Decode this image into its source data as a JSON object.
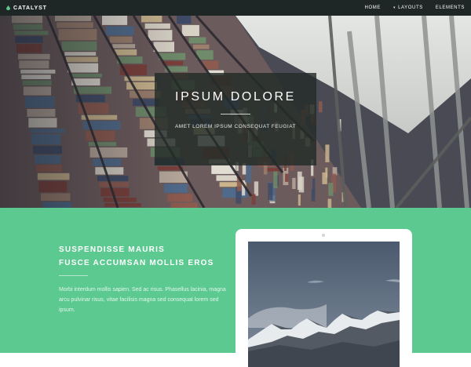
{
  "nav": {
    "brand": "CATALYST",
    "links": [
      {
        "label": "HOME",
        "has_caret": false
      },
      {
        "label": "LAYOUTS",
        "has_caret": true
      },
      {
        "label": "ELEMENTS",
        "has_caret": false
      }
    ]
  },
  "hero": {
    "title": "IPSUM DOLORE",
    "subtitle": "AMET LOREM IPSUM CONSEQUAT FEUGIAT"
  },
  "feature": {
    "heading_line1": "SUSPENDISSE MAURIS",
    "heading_line2": "FUSCE ACCUMSAN MOLLIS EROS",
    "body": "Morbi interdum mollis sapien. Sed ac risus. Phasellus lacinia, magna arcu pulvinar risus, vitae facilisis magna sed consequat lorem sed ipsum."
  },
  "colors": {
    "nav_bg": "#1f2626",
    "accent_green": "#5cc991",
    "hero_overlay": "#232c28"
  },
  "icons": {
    "brand": "drop-icon",
    "dropdown": "caret-icon"
  }
}
